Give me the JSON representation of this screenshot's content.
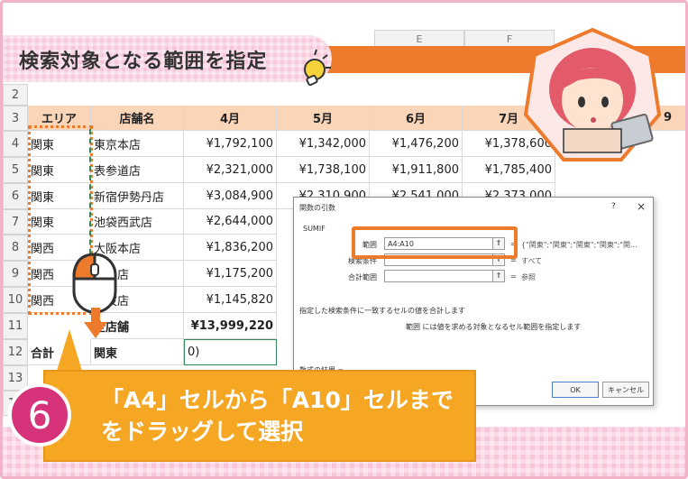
{
  "banner": {
    "title": "検索対象となる範囲を指定"
  },
  "columns": {
    "e": "E",
    "f": "F"
  },
  "rows": [
    "2",
    "3",
    "4",
    "5",
    "6",
    "7",
    "8",
    "9",
    "10",
    "11",
    "12",
    "13",
    "14"
  ],
  "table": {
    "headers": [
      "エリア",
      "店舗名",
      "4月",
      "5月",
      "6月",
      "7月",
      "9"
    ],
    "data": [
      [
        "関東",
        "東京本店",
        "¥1,792,100",
        "¥1,342,000",
        "¥1,476,200",
        "¥1,378,600"
      ],
      [
        "関東",
        "表参道店",
        "¥2,321,000",
        "¥1,738,100",
        "¥1,911,800",
        "¥1,785,400"
      ],
      [
        "関東",
        "新宿伊勢丹店",
        "¥3,084,900",
        "¥2,310,900",
        "¥2,541,000",
        "¥2,373,000"
      ],
      [
        "関東",
        "池袋西武店",
        "¥2,644,000",
        "",
        "",
        ""
      ],
      [
        "関西",
        "大阪本店",
        "¥1,836,200",
        "",
        "",
        ""
      ],
      [
        "関西",
        "梅田店",
        "¥1,175,200",
        "",
        "",
        ""
      ],
      [
        "関西",
        "難波店",
        "¥1,145,820",
        "",
        "",
        ""
      ]
    ],
    "total_label": "全店舗",
    "total_value": "¥13,999,220",
    "sum_label": "合計",
    "sum_area": "関東",
    "sum_formula": "0)"
  },
  "dialog": {
    "title": "関数の引数",
    "help": "?",
    "close": "×",
    "function_name": "SUMIF",
    "range_label": "範囲",
    "range_value": "A4:A10",
    "range_result": "{\"関東\";\"関東\";\"関東\";\"関東\";\"関...",
    "criteria_label": "検索条件",
    "criteria_result": "すべて",
    "sum_range_label": "合計範囲",
    "sum_range_result": "参照",
    "description": "指定した検索条件に一致するセルの値を合計します",
    "arg_description": "範囲  には値を求める対象となるセル範囲を指定します",
    "help_link": "数式の結果 =",
    "ok": "OK",
    "cancel": "キャンセル",
    "eq": "="
  },
  "step": {
    "number": "6",
    "line1": "「A4」セルから「A10」セルまで",
    "line2": "をドラッグして選択"
  },
  "colors": {
    "accent": "#ee7a2b",
    "pink": "#f7c6d8",
    "step": "#d6337a",
    "callout": "#f5a623"
  }
}
